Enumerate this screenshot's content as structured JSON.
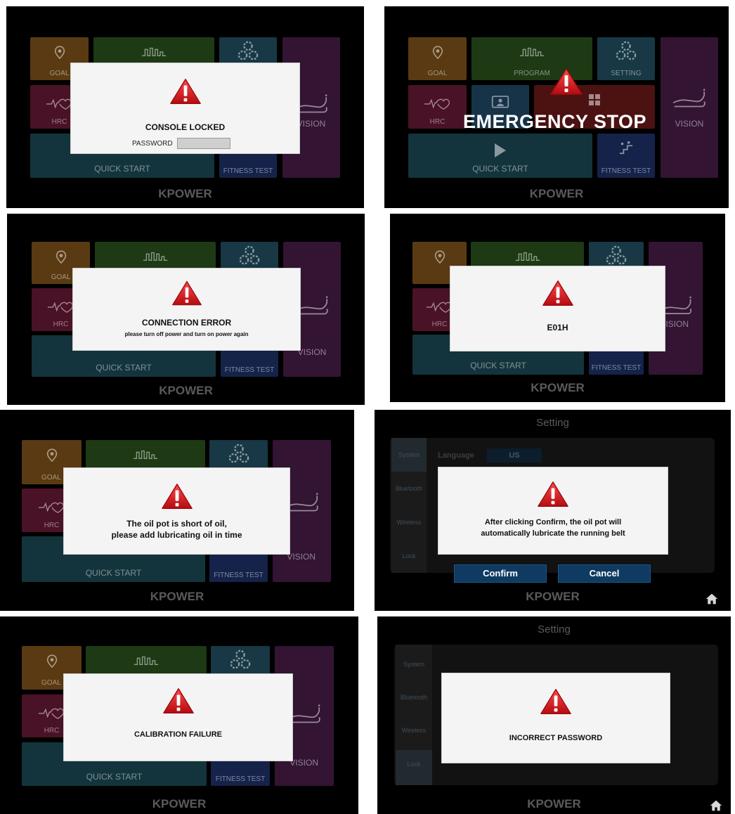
{
  "home_menu": {
    "goal": "GOAL",
    "program": "PROGRAM",
    "setting": "SETTING",
    "hrc": "HRC",
    "vision": "VISION",
    "quick_start": "QUICK START",
    "fitness_test": "FITNESS TEST",
    "brand": "KPOWER"
  },
  "alerts": {
    "console_locked": {
      "title": "CONSOLE LOCKED",
      "password_label": "PASSWORD",
      "password_value": ""
    },
    "emergency_stop": {
      "title": "EMERGENCY STOP"
    },
    "connection_error": {
      "title": "CONNECTION ERROR",
      "message": "please turn off power and turn on power again"
    },
    "error_code": {
      "title": "E01H"
    },
    "oil_short": {
      "line1": "The oil pot is short of oil,",
      "line2": "please add lubricating oil in time"
    },
    "oil_confirm": {
      "line1": "After clicking Confirm, the oil pot will",
      "line2": "automatically lubricate the running belt",
      "confirm_label": "Confirm",
      "cancel_label": "Cancel"
    },
    "calibration": {
      "title": "CALIBRATION FAILURE"
    },
    "incorrect_password": {
      "title": "INCORRECT PASSWORD"
    }
  },
  "setting": {
    "title": "Setting",
    "tabs": [
      "System",
      "Bluetooth",
      "Wireless",
      "Lock"
    ],
    "language_label": "Language",
    "language_value": "US"
  },
  "icons": [
    "warning-triangle-icon",
    "location-pin-icon",
    "program-wave-icon",
    "gears-icon",
    "heart-pulse-icon",
    "treadmill-icon",
    "play-icon",
    "stairs-icon",
    "user-folder-icon",
    "grid-icon",
    "home-icon"
  ],
  "colors": {
    "warning_red": "#d8141c",
    "dialog_bg": "#f4f4f4",
    "button_blue": "#0f3b63"
  }
}
